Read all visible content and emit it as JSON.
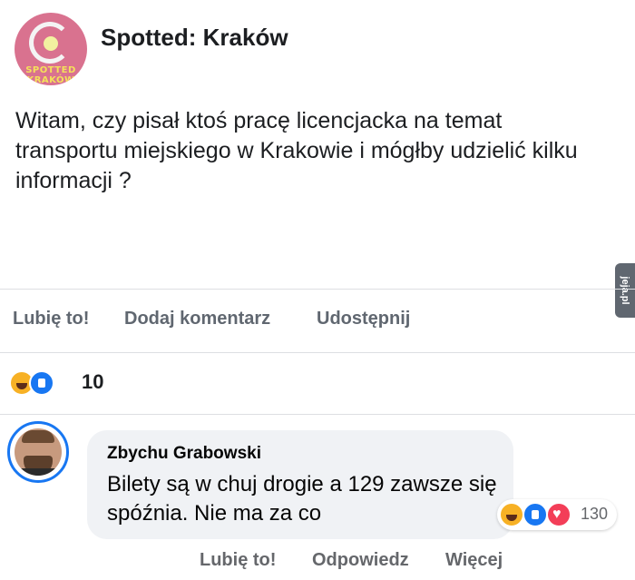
{
  "post": {
    "page_name": "Spotted: Kraków",
    "avatar_logo_text": "SPOTTED KRAKÓW",
    "text": "Witam, czy pisał ktoś pracę licencjacka na temat transportu miejskiego w Krakowie i mógłby udzielić kilku informacji ?"
  },
  "actions": {
    "like": "Lubię to!",
    "comment": "Dodaj komentarz",
    "share": "Udostępnij"
  },
  "watermark": "jeja.pl",
  "reactions": {
    "icons": [
      "haha-icon",
      "like-icon"
    ],
    "count": "10"
  },
  "comment": {
    "author": "Zbychu Grabowski",
    "text": "Bilety są w chuj drogie a 129 zawsze się spóźnia. Nie ma za co",
    "reaction_icons": [
      "haha-icon",
      "like-icon",
      "love-icon"
    ],
    "reaction_count": "130",
    "actions": {
      "like": "Lubię to!",
      "reply": "Odpowiedz",
      "more": "Więcej"
    }
  },
  "colors": {
    "like_blue": "#1877f2",
    "haha_yellow": "#f7b125",
    "love_red": "#f33e58",
    "secondary_text": "#606770",
    "bubble_bg": "#f0f2f5"
  }
}
